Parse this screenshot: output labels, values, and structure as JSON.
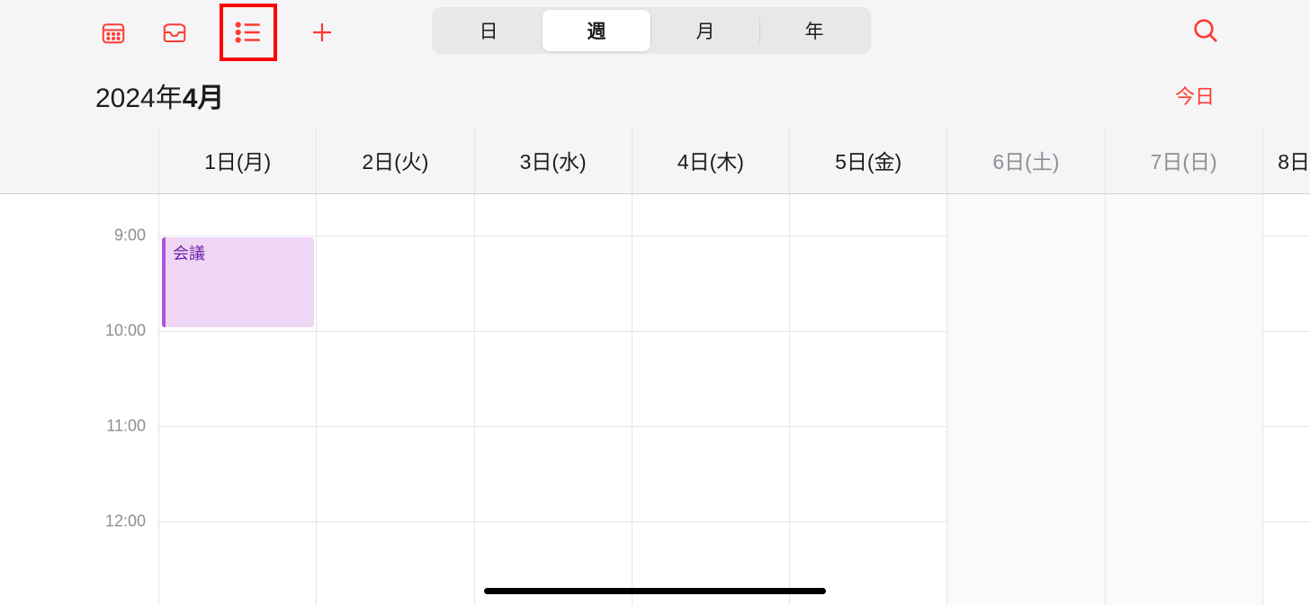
{
  "toolbar": {
    "icons": {
      "calendars": "calendars-icon",
      "inbox": "inbox-icon",
      "list": "list-icon",
      "add": "plus-icon",
      "search": "search-icon"
    }
  },
  "segmented": {
    "day": "日",
    "week": "週",
    "month": "月",
    "year": "年",
    "active": "week"
  },
  "titleRow": {
    "year_prefix": "2024年",
    "month_bold": "4月",
    "today": "今日"
  },
  "days": [
    {
      "label": "1日(月)",
      "weekend": false
    },
    {
      "label": "2日(火)",
      "weekend": false
    },
    {
      "label": "3日(水)",
      "weekend": false
    },
    {
      "label": "4日(木)",
      "weekend": false
    },
    {
      "label": "5日(金)",
      "weekend": false
    },
    {
      "label": "6日(土)",
      "weekend": true
    },
    {
      "label": "7日(日)",
      "weekend": true
    },
    {
      "label": "8日",
      "weekend": false
    }
  ],
  "hours": [
    "9:00",
    "10:00",
    "11:00",
    "12:00"
  ],
  "events": [
    {
      "title": "会議",
      "dayIndex": 0,
      "startHour": 9,
      "endHour": 10,
      "color": "#af52de",
      "bg": "#f0d6f5"
    }
  ]
}
